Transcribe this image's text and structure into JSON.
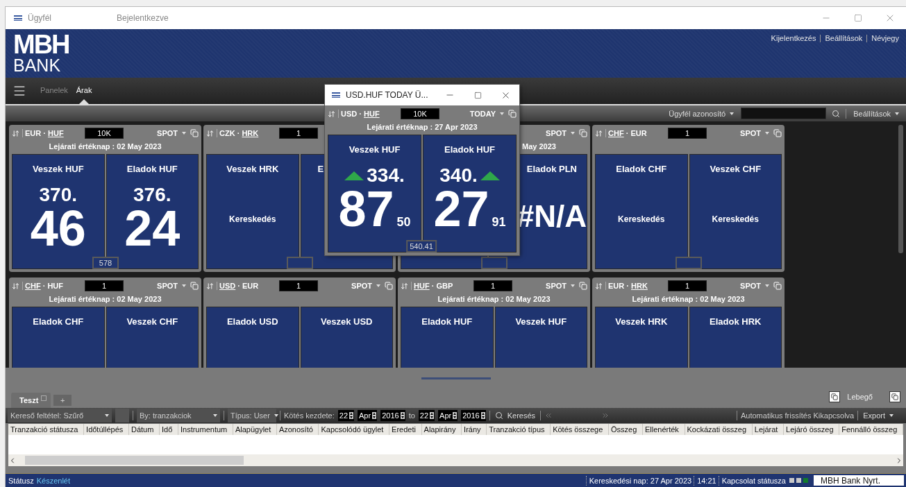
{
  "window": {
    "title": "Ügyfél",
    "status": "Bejelentkezve"
  },
  "logo": {
    "top": "MBH",
    "bottom": "BANK"
  },
  "header_links": [
    "Kijelentkezés",
    "Beállítások",
    "Névjegy"
  ],
  "nav_tabs": [
    {
      "label": "Panelek",
      "selected": false
    },
    {
      "label": "Árak",
      "selected": true
    }
  ],
  "toolbar": {
    "client_id_label": "Ügyfél azonosító",
    "settings": "Beállítások"
  },
  "tiles": [
    {
      "base": {
        "code": "EUR",
        "underlined": false
      },
      "separator": "·",
      "quote": {
        "code": "HUF",
        "underlined": true
      },
      "amount": "10K",
      "mode": "SPOT",
      "date": "Lejárati értéknap : 02 May 2023",
      "sides": [
        {
          "kind": "price",
          "title": "Veszek HUF",
          "prefix": "370.",
          "big": "46"
        },
        {
          "kind": "price",
          "title": "Eladok HUF",
          "prefix": "376.",
          "big": "24"
        }
      ],
      "spread": "578"
    },
    {
      "base": {
        "code": "CZK",
        "underlined": false
      },
      "separator": "·",
      "quote": {
        "code": "HRK",
        "underlined": true
      },
      "amount": "1",
      "sides": [
        {
          "kind": "status",
          "title": "Veszek HRK",
          "text": "Kereskedés"
        },
        {
          "kind": "blank",
          "title": "E"
        }
      ]
    },
    {
      "mode": "SPOT",
      "date": "May 2023",
      "sides": [
        {
          "kind": "blank"
        },
        {
          "kind": "na",
          "title": "Eladok PLN",
          "text": "#N/A"
        }
      ]
    },
    {
      "base": {
        "code": "CHF",
        "underlined": true
      },
      "separator": "·",
      "quote": {
        "code": "EUR",
        "underlined": false
      },
      "amount": "1",
      "mode": "SPOT",
      "sides": [
        {
          "kind": "status",
          "title": "Eladok CHF",
          "text": "Kereskedés"
        },
        {
          "kind": "status",
          "title": "Veszek CHF",
          "text": "Kereskedés"
        }
      ]
    },
    {
      "base": {
        "code": "CHF",
        "underlined": true
      },
      "separator": "·",
      "quote": {
        "code": "HUF",
        "underlined": false
      },
      "amount": "1",
      "mode": "SPOT",
      "date": "Lejárati értéknap : 02 May 2023",
      "sides": [
        {
          "kind": "blank",
          "title": "Eladok CHF"
        },
        {
          "kind": "blank",
          "title": "Veszek CHF"
        }
      ]
    },
    {
      "base": {
        "code": "USD",
        "underlined": true
      },
      "separator": "·",
      "quote": {
        "code": "EUR",
        "underlined": false
      },
      "amount": "1",
      "mode": "SPOT",
      "sides": [
        {
          "kind": "blank",
          "title": "Eladok USD"
        },
        {
          "kind": "blank",
          "title": "Veszek USD"
        }
      ]
    },
    {
      "base": {
        "code": "HUF",
        "underlined": true
      },
      "separator": "·",
      "quote": {
        "code": "GBP",
        "underlined": false
      },
      "amount": "1",
      "mode": "SPOT",
      "date": "Lejárati értéknap : 02 May 2023",
      "sides": [
        {
          "kind": "blank",
          "title": "Eladok HUF"
        },
        {
          "kind": "blank",
          "title": "Veszek HUF"
        }
      ]
    },
    {
      "base": {
        "code": "EUR",
        "underlined": false
      },
      "separator": "·",
      "quote": {
        "code": "HRK",
        "underlined": true
      },
      "amount": "1",
      "mode": "SPOT",
      "date": "Lejárati értéknap : 02 May 2023",
      "sides": [
        {
          "kind": "blank",
          "title": "Veszek HRK"
        },
        {
          "kind": "blank",
          "title": "Eladok HRK"
        }
      ]
    }
  ],
  "float_window": {
    "title": "USD.HUF TODAY Ü...",
    "tile": {
      "base": {
        "code": "USD",
        "underlined": false
      },
      "separator": "·",
      "quote": {
        "code": "HUF",
        "underlined": true
      },
      "amount": "10K",
      "mode": "TODAY",
      "date": "Lejárati értéknap : 27 Apr 2023",
      "sides": [
        {
          "kind": "price",
          "title": "Veszek HUF",
          "prefix": "334.",
          "big": "87",
          "small": "50",
          "rising": true
        },
        {
          "kind": "price",
          "title": "Eladok HUF",
          "prefix": "340.",
          "big": "27",
          "small": "91",
          "rising": true
        }
      ],
      "spread": "540.41"
    }
  },
  "bottom_tabs": [
    {
      "label": "Teszt",
      "selected": true
    }
  ],
  "add_tab": "+",
  "float_toggle": "Lebegő",
  "filters": {
    "criteria_label": "Kereső feltétel:",
    "criteria": "Szűrő",
    "by_label": "By:",
    "by": "tranzakciok",
    "type_label": "Típus:",
    "type": "User",
    "date_label": "Kötés kezdete:",
    "from": {
      "day": "22",
      "month": "Apr",
      "year": "2016"
    },
    "to_label": "to",
    "to": {
      "day": "22",
      "month": "Apr",
      "year": "2016"
    },
    "search": "Keresés",
    "auto_refresh": "Automatikus frissítés Kikapcsolva",
    "export": "Export"
  },
  "columns": [
    "Tranzakció státusza",
    "Időtúllépés",
    "Dátum",
    "Idő",
    "Instrumentum",
    "Alapügylet",
    "Azonosító",
    "Kapcsolódó ügylet",
    "Eredeti",
    "Alapirány",
    "Irány",
    "Tranzakció típus",
    "Kötés összege",
    "Összeg",
    "Ellenérték",
    "Kockázati összeg",
    "Lejárat",
    "Lejáró összeg",
    "Fennálló összeg"
  ],
  "status": {
    "label": "Státusz",
    "value": "Készenlét",
    "trading_day": "Kereskedési nap: 27 Apr 2023",
    "time": "14:21",
    "connection": "Kapcsolat státusza",
    "indicators": [
      {
        "color": "#c8c8c8"
      },
      {
        "color": "#c8c8c8"
      },
      {
        "color": "#127a2c"
      }
    ],
    "company": "MBH Bank Nyrt."
  }
}
